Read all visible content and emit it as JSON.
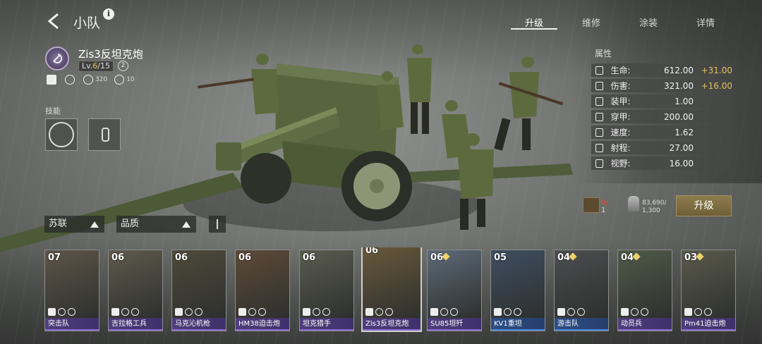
{
  "header": {
    "title": "小队",
    "tabs": [
      {
        "label": "升级",
        "active": true
      },
      {
        "label": "维修",
        "active": false
      },
      {
        "label": "涂装",
        "active": false
      },
      {
        "label": "详情",
        "active": false
      }
    ]
  },
  "unit": {
    "name": "Zis3反坦克炮",
    "level_prefix": "Lv.",
    "level_current": "6",
    "level_max": "/15",
    "count": "2",
    "stats": {
      "supply": "320",
      "soldiers": "10"
    },
    "faction_icon": "hammer-sickle-icon"
  },
  "skills": {
    "label": "技能"
  },
  "attributes": {
    "title": "属性",
    "rows": [
      {
        "icon": "hp-icon",
        "name": "生命:",
        "value": "612.00",
        "bonus": "+31.00"
      },
      {
        "icon": "damage-icon",
        "name": "伤害:",
        "value": "321.00",
        "bonus": "+16.00"
      },
      {
        "icon": "armor-icon",
        "name": "装甲:",
        "value": "1.00",
        "bonus": ""
      },
      {
        "icon": "penetration-icon",
        "name": "穿甲:",
        "value": "200.00",
        "bonus": ""
      },
      {
        "icon": "speed-icon",
        "name": "速度:",
        "value": "1.62",
        "bonus": ""
      },
      {
        "icon": "range-icon",
        "name": "射程:",
        "value": "27.00",
        "bonus": ""
      },
      {
        "icon": "vision-icon",
        "name": "视野:",
        "value": "16.00",
        "bonus": ""
      }
    ]
  },
  "upgrade": {
    "resource1_have": "0/",
    "resource1_need": "1",
    "resource2_have": "83,690/",
    "resource2_need": "1,300",
    "button_label": "升级"
  },
  "filters": {
    "faction": "苏联",
    "quality": "品质"
  },
  "cards": [
    {
      "level": "07",
      "star": false,
      "name": "突击队",
      "tier": "purple",
      "selected": false
    },
    {
      "level": "06",
      "star": false,
      "name": "吉拉格工兵",
      "tier": "purple",
      "selected": false
    },
    {
      "level": "06",
      "star": false,
      "name": "马克沁机枪",
      "tier": "purple",
      "selected": false
    },
    {
      "level": "06",
      "star": false,
      "name": "HM38迫击炮",
      "tier": "purple",
      "selected": false
    },
    {
      "level": "06",
      "star": false,
      "name": "坦克猎手",
      "tier": "purple",
      "selected": false
    },
    {
      "level": "06",
      "star": false,
      "name": "Zis3反坦克炮",
      "tier": "purple",
      "selected": true
    },
    {
      "level": "06",
      "star": true,
      "name": "SU85坦歼",
      "tier": "purple",
      "selected": false
    },
    {
      "level": "05",
      "star": false,
      "name": "KV1重坦",
      "tier": "blue",
      "selected": false
    },
    {
      "level": "04",
      "star": true,
      "name": "游击队",
      "tier": "blue",
      "selected": false
    },
    {
      "level": "04",
      "star": true,
      "name": "动员兵",
      "tier": "purple",
      "selected": false
    },
    {
      "level": "03",
      "star": true,
      "name": "Pm41迫击炮",
      "tier": "purple",
      "selected": false
    }
  ]
}
